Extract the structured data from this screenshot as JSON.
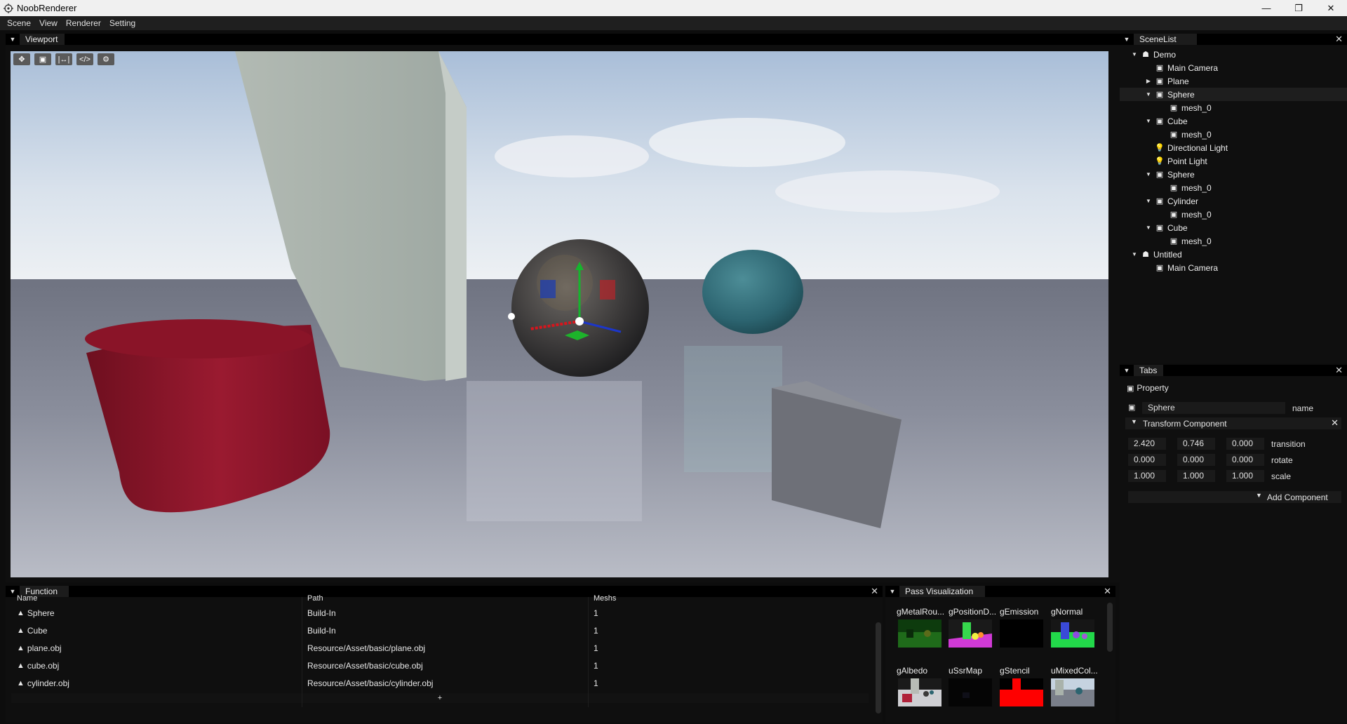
{
  "window": {
    "title": "NoobRenderer",
    "min_icon": "minimize-icon",
    "max_icon": "maximize-icon",
    "close_icon": "close-icon"
  },
  "menu": [
    "Scene",
    "View",
    "Renderer",
    "Setting"
  ],
  "viewport": {
    "tab_label": "Viewport",
    "tools": [
      "move-icon",
      "scale-icon",
      "fit-icon",
      "code-icon",
      "gear-icon"
    ]
  },
  "scenelist": {
    "tab_label": "SceneList",
    "items": [
      {
        "label": "Demo",
        "depth": 0,
        "toggle": "open",
        "icon": "scene-icon"
      },
      {
        "label": "Main Camera",
        "depth": 1,
        "toggle": "none",
        "icon": "camera-icon"
      },
      {
        "label": "Plane",
        "depth": 1,
        "toggle": "closed",
        "icon": "cube-icon"
      },
      {
        "label": "Sphere",
        "depth": 1,
        "toggle": "open",
        "icon": "cube-icon",
        "selected": true
      },
      {
        "label": "mesh_0",
        "depth": 2,
        "toggle": "none",
        "icon": "cube-icon"
      },
      {
        "label": "Cube",
        "depth": 1,
        "toggle": "open",
        "icon": "cube-icon"
      },
      {
        "label": "mesh_0",
        "depth": 2,
        "toggle": "none",
        "icon": "cube-icon"
      },
      {
        "label": "Directional Light",
        "depth": 1,
        "toggle": "none",
        "icon": "light-icon"
      },
      {
        "label": "Point Light",
        "depth": 1,
        "toggle": "none",
        "icon": "light-icon"
      },
      {
        "label": "Sphere",
        "depth": 1,
        "toggle": "open",
        "icon": "cube-icon"
      },
      {
        "label": "mesh_0",
        "depth": 2,
        "toggle": "none",
        "icon": "cube-icon"
      },
      {
        "label": "Cylinder",
        "depth": 1,
        "toggle": "open",
        "icon": "cube-icon"
      },
      {
        "label": "mesh_0",
        "depth": 2,
        "toggle": "none",
        "icon": "cube-icon"
      },
      {
        "label": "Cube",
        "depth": 1,
        "toggle": "open",
        "icon": "cube-icon"
      },
      {
        "label": "mesh_0",
        "depth": 2,
        "toggle": "none",
        "icon": "cube-icon"
      },
      {
        "label": "Untitled",
        "depth": 0,
        "toggle": "open",
        "icon": "scene-icon"
      },
      {
        "label": "Main Camera",
        "depth": 1,
        "toggle": "none",
        "icon": "camera-icon"
      }
    ]
  },
  "tabs": {
    "tab_label": "Tabs",
    "property_label": "Property",
    "name_value": "Sphere",
    "name_label": "name",
    "transform_label": "Transform Component",
    "transition": [
      "2.420",
      "0.746",
      "0.000"
    ],
    "transition_label": "transition",
    "rotate": [
      "0.000",
      "0.000",
      "0.000"
    ],
    "rotate_label": "rotate",
    "scale": [
      "1.000",
      "1.000",
      "1.000"
    ],
    "scale_label": "scale",
    "add_component_label": "Add Component"
  },
  "function": {
    "tab_label": "Function",
    "columns": [
      "Name",
      "Path",
      "Meshs"
    ],
    "rows": [
      {
        "name": "Sphere",
        "path": "Build-In",
        "meshs": "1"
      },
      {
        "name": "Cube",
        "path": "Build-In",
        "meshs": "1"
      },
      {
        "name": "plane.obj",
        "path": "Resource/Asset/basic/plane.obj",
        "meshs": "1"
      },
      {
        "name": "cube.obj",
        "path": "Resource/Asset/basic/cube.obj",
        "meshs": "1"
      },
      {
        "name": "cylinder.obj",
        "path": "Resource/Asset/basic/cylinder.obj",
        "meshs": "1"
      }
    ],
    "add_label": "+"
  },
  "passvis": {
    "tab_label": "Pass Visualization",
    "passes": [
      "gMetalRou...",
      "gPositionD...",
      "gEmission",
      "gNormal",
      "gAlbedo",
      "uSsrMap",
      "gStencil",
      "uMixedCol..."
    ]
  }
}
